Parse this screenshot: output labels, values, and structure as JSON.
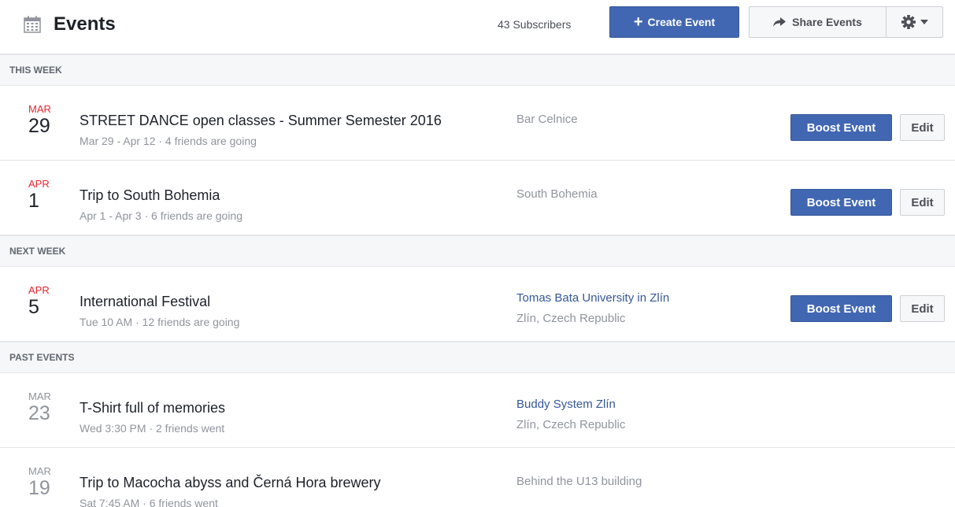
{
  "header": {
    "icon": "calendar-icon",
    "title": "Events",
    "subscribers": "43 Subscribers",
    "create_label": "Create Event",
    "share_label": "Share Events",
    "settings_icon": "gear-icon"
  },
  "colors": {
    "primary": "#4267b2",
    "link": "#365899",
    "upcoming_month": "#e9262f",
    "muted": "#90949c",
    "section_bg": "#f6f7f9"
  },
  "sections": {
    "this_week": "THIS WEEK",
    "next_week": "NEXT WEEK",
    "past_events": "PAST EVENTS"
  },
  "events": [
    {
      "month": "MAR",
      "day": "29",
      "title": "STREET DANCE open classes - Summer Semester 2016",
      "meta": "Mar 29 - Apr 12 · 4 friends are going",
      "location": "Bar Celnice",
      "boost_label": "Boost Event",
      "edit_label": "Edit"
    },
    {
      "month": "APR",
      "day": "1",
      "title": "Trip to South Bohemia",
      "meta": "Apr 1 - Apr 3 · 6 friends are going",
      "location": "South Bohemia",
      "boost_label": "Boost Event",
      "edit_label": "Edit"
    },
    {
      "month": "APR",
      "day": "5",
      "title": "International Festival",
      "meta": "Tue 10 AM · 12 friends are going",
      "location": "Tomas Bata University in Zlín",
      "location_sub": "Zlín, Czech Republic",
      "boost_label": "Boost Event",
      "edit_label": "Edit"
    },
    {
      "month": "MAR",
      "day": "23",
      "title": "T-Shirt full of memories",
      "meta": "Wed 3:30 PM · 2 friends went",
      "location": "Buddy System Zlín",
      "location_sub": "Zlín, Czech Republic"
    },
    {
      "month": "MAR",
      "day": "19",
      "title": "Trip to Macocha abyss and Černá Hora brewery",
      "meta": "Sat 7:45 AM · 6 friends went",
      "location": "Behind the U13 building"
    }
  ]
}
